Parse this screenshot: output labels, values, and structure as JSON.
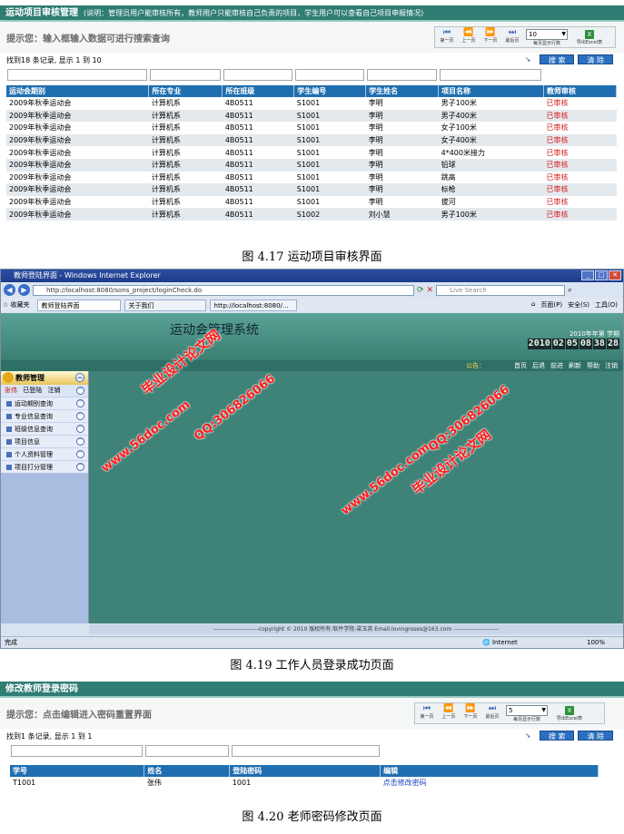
{
  "panel1": {
    "title": "运动项目审核管理",
    "note": "(说明：管理员用户能审核所有，教师用户只能审核自己负责的项目，学生用户可以查看自己项目申报情况)",
    "hint": "提示您：输入框输入数据可进行搜索查询",
    "pager": {
      "first": "第一页",
      "prev": "上一页",
      "next": "下一页",
      "last": "最后页",
      "page_size": "10",
      "page_size_caption": "每页显示行数",
      "excel": "导出Excel表"
    },
    "count": "找到18 条记录, 显示 1 到 10",
    "search_btn": "搜 索",
    "clear_btn": "清 除",
    "columns": [
      "运动会期别",
      "所在专业",
      "所在班级",
      "学生编号",
      "学生姓名",
      "项目名称",
      "教师审核"
    ],
    "rows": [
      [
        "2009年秋季运动会",
        "计算机系",
        "4B0511",
        "S1001",
        "李明",
        "男子100米",
        "已审核"
      ],
      [
        "2009年秋季运动会",
        "计算机系",
        "4B0511",
        "S1001",
        "李明",
        "男子400米",
        "已审核"
      ],
      [
        "2009年秋季运动会",
        "计算机系",
        "4B0511",
        "S1001",
        "李明",
        "女子100米",
        "已审核"
      ],
      [
        "2009年秋季运动会",
        "计算机系",
        "4B0511",
        "S1001",
        "李明",
        "女子400米",
        "已审核"
      ],
      [
        "2009年秋季运动会",
        "计算机系",
        "4B0511",
        "S1001",
        "李明",
        "4*400米接力",
        "已审核"
      ],
      [
        "2009年秋季运动会",
        "计算机系",
        "4B0511",
        "S1001",
        "李明",
        "铅球",
        "已审核"
      ],
      [
        "2009年秋季运动会",
        "计算机系",
        "4B0511",
        "S1001",
        "李明",
        "跳高",
        "已审核"
      ],
      [
        "2009年秋季运动会",
        "计算机系",
        "4B0511",
        "S1001",
        "李明",
        "标枪",
        "已审核"
      ],
      [
        "2009年秋季运动会",
        "计算机系",
        "4B0511",
        "S1001",
        "李明",
        "拔河",
        "已审核"
      ],
      [
        "2009年秋季运动会",
        "计算机系",
        "4B0511",
        "S1002",
        "刘小慧",
        "男子100米",
        "已审核"
      ]
    ]
  },
  "caption1": "图 4.17  运动项目审核界面",
  "browser": {
    "title": "教师登陆界面 - Windows Internet Explorer",
    "address": "http://localhost:8080/sons_project/loginCheck.do",
    "live_search": "Live Search",
    "favorites": "收藏夹",
    "tabs": [
      "教师登陆界面",
      "关于我们",
      "http://localhost:8080/..."
    ],
    "tools": [
      "页面(P)",
      "安全(S)",
      "工具(O)"
    ],
    "site_title": "运动会管理系统",
    "year_term": "2010年年第   学期",
    "clock": [
      "2010",
      "02",
      "05",
      "08",
      "38",
      "28"
    ],
    "notice_label": "公告：",
    "top_links": [
      "首页",
      "后退",
      "前进",
      "刷新",
      "帮助",
      "注销"
    ],
    "menu_title": "教师管理",
    "user_name": "张伟",
    "user_status": "已登陆",
    "logout": "注销",
    "menu_items": [
      "运动期别查询",
      "专业信息查询",
      "班级信息查询",
      "项目信息",
      "个人资料管理",
      "项目打分管理"
    ],
    "footer": "-----------------------copyright © 2010 版权所有:软件学院-梁玉英  Email:lovingroses@163.com -----------------------",
    "status_left": "完成",
    "status_zone": "Internet",
    "status_zoom": "100%"
  },
  "watermarks": [
    "毕业设计论文网",
    "www.56doc.com",
    "QQ:306826066"
  ],
  "caption2": "图 4.19  工作人员登录成功页面",
  "panel2": {
    "title": "修改教师登录密码",
    "hint": "提示您：点击编辑进入密码重置界面",
    "pager": {
      "first": "第一页",
      "prev": "上一页",
      "next": "下一页",
      "last": "最后页",
      "page_size": "5",
      "page_size_caption": "每页显示行数",
      "excel": "导出Excel表"
    },
    "count": "找到1 条记录, 显示 1 到 1",
    "search_btn": "搜 索",
    "clear_btn": "清 除",
    "columns": [
      "学号",
      "姓名",
      "登陆密码",
      "编辑"
    ],
    "rows": [
      [
        "T1001",
        "张伟",
        "1001",
        "点击修改密码"
      ]
    ]
  },
  "caption3": "图 4.20 老师密码修改页面"
}
